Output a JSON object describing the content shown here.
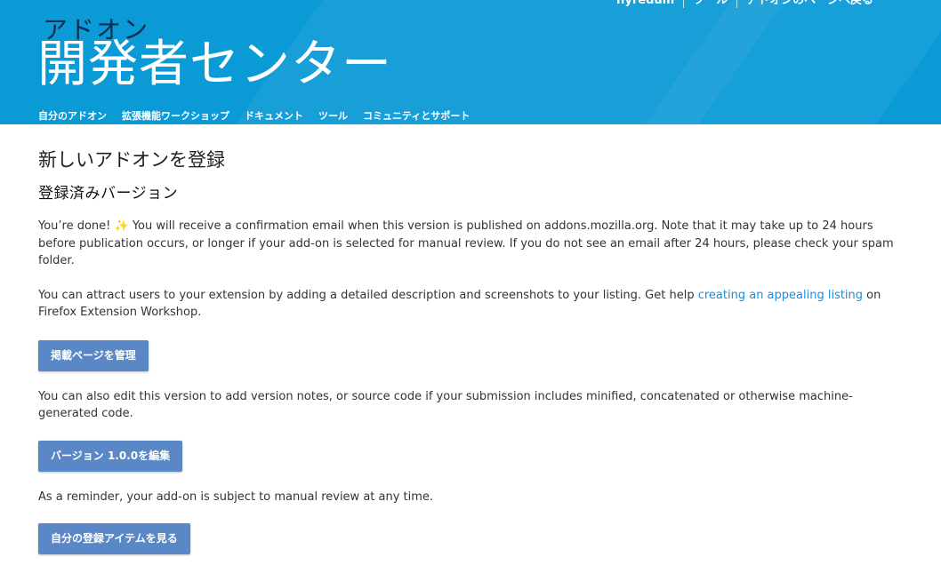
{
  "header": {
    "top_links": [
      "flyredum",
      "ツール",
      "アドオンのページへ戻る"
    ],
    "brand_small": "アドオン",
    "brand_big": "開発者センター",
    "nav": [
      "自分のアドオン",
      "拡張機能ワークショップ",
      "ドキュメント",
      "ツール",
      "コミュニティとサポート"
    ]
  },
  "main": {
    "page_title": "新しいアドオンを登録",
    "section_title": "登録済みバージョン",
    "done_text_1": "You’re done! ",
    "done_emoji": "✨",
    "done_text_2": " You will receive a confirmation email when this version is published on addons.mozilla.org. Note that it may take up to 24 hours before publication occurs, or longer if your add-on is selected for manual review. If you do not see an email after 24 hours, please check your spam folder.",
    "attract_text_1": "You can attract users to your extension by adding a detailed description and screenshots to your listing. Get help ",
    "attract_link": "creating an appealing listing",
    "attract_text_2": " on Firefox Extension Workshop.",
    "manage_button": "掲載ページを管理",
    "edit_text": "You can also edit this version to add version notes, or source code if your submission includes minified, concatenated or otherwise machine-generated code.",
    "edit_button": "バージョン 1.0.0を編集",
    "reminder_text": "As a reminder, your add-on is subject to manual review at any time.",
    "my_items_button": "自分の登録アイテムを見る"
  },
  "colors": {
    "header_bg": "#0a9ad6",
    "brand_small": "#0b2e52",
    "button_bg": "#5a87c5",
    "link": "#1f8dd6"
  }
}
